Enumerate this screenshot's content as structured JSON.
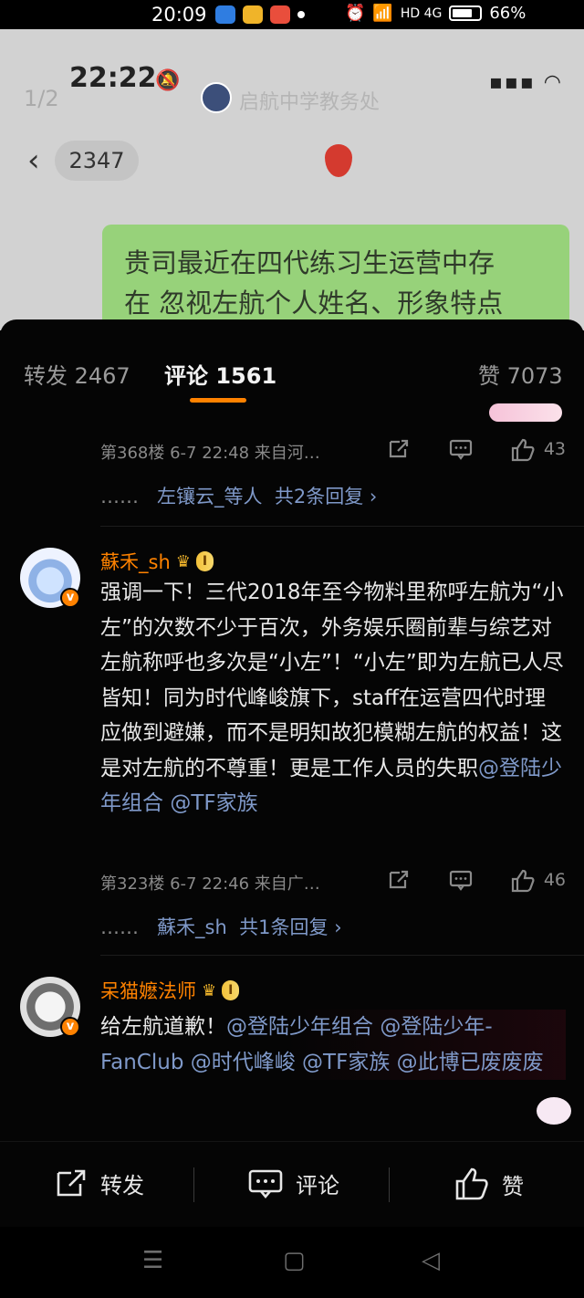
{
  "status_bar": {
    "time": "20:09",
    "battery": "66%",
    "signal_labels": "HD 4G"
  },
  "chat_screenshot": {
    "time": "22:22",
    "pager": "1/2",
    "account_name": "启航中学教务处",
    "badge_count": "2347",
    "message_line1": "贵司最近在四代练习生运营中存",
    "message_line2": "在 忽视左航个人姓名、形象特点"
  },
  "tabs": {
    "repost": "转发 2467",
    "comments": "评论 1561",
    "likes": "赞 7073"
  },
  "comment_prev": {
    "meta": "第368楼  6-7 22:48  来自河…",
    "likes": "43",
    "replies_prefix": "……",
    "replies_link": "左镶云_等人",
    "replies_count": "共2条回复 ›"
  },
  "comment1": {
    "username": "蘇禾_sh",
    "level": "I",
    "body_text": "强调一下！三代2018年至今物料里称呼左航为“小左”的次数不少于百次，外务娱乐圈前辈与综艺对左航称呼也多次是“小左”！“小左”即为左航已人尽皆知！同为时代峰峻旗下，staff在运营四代时理应做到避嫌，而不是明知故犯模糊左航的权益！这是对左航的不尊重！更是工作人员的失职",
    "mention1": "@登陆少年组合",
    "mention2": "@TF家族",
    "meta": "第323楼  6-7 22:46  来自广…",
    "likes": "46",
    "replies_prefix": "……",
    "replies_link": "蘇禾_sh",
    "replies_count": "共1条回复 ›"
  },
  "comment2": {
    "username": "呆猫嬷法师",
    "level": "I",
    "body_text": "给左航道歉！",
    "mention1": "@登陆少年组合",
    "mention2": "@登陆少年-FanClub",
    "mention3": "@时代峰峻",
    "mention4": "@TF家族",
    "mention5": "@此博已废废废"
  },
  "bottom_bar": {
    "repost": "转发",
    "comment": "评论",
    "like": "赞"
  },
  "colors": {
    "accent": "#ff8200",
    "link": "#7f99c9",
    "bubble": "#97d27a"
  }
}
